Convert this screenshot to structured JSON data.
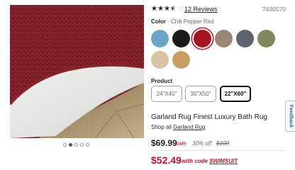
{
  "rating": {
    "value": 3.5,
    "max": 5,
    "reviews_label": "12 Reviews"
  },
  "sku": "7430570",
  "color": {
    "label": "Color",
    "separator": " - ",
    "selected": "Chili Pepper Red",
    "swatches": [
      {
        "name": "light-blue",
        "hex": "#6aa6c9"
      },
      {
        "name": "black",
        "hex": "#1a1a1a"
      },
      {
        "name": "chili-pepper-red",
        "hex": "#a3141e",
        "selected": true
      },
      {
        "name": "taupe",
        "hex": "#9a8674"
      },
      {
        "name": "slate-gray",
        "hex": "#5d646b"
      },
      {
        "name": "sage-green",
        "hex": "#7e8a5c"
      },
      {
        "name": "linen",
        "hex": "#d9c3a0"
      },
      {
        "name": "gold",
        "hex": "#c79f62"
      }
    ]
  },
  "product": {
    "label": "Product",
    "sizes": [
      {
        "label": "24\"X40\"",
        "selected": false
      },
      {
        "label": "30\"X50\"",
        "selected": false
      },
      {
        "label": "22\"X60\"",
        "selected": true
      }
    ]
  },
  "title": "Garland Rug Finest Luxury Bath Rug",
  "shop_all": {
    "prefix": "Shop all ",
    "brand": "Garland Rug"
  },
  "pricing": {
    "price": "$69.99",
    "sale": "sale",
    "percent_off": "30% off",
    "original": "$100",
    "promo_price": "$52.49",
    "promo_prefix": "with code ",
    "promo_code": "SWIMSUIT"
  },
  "carousel": {
    "count": 5,
    "active_index": 1
  },
  "feedback_label": "Feedback"
}
